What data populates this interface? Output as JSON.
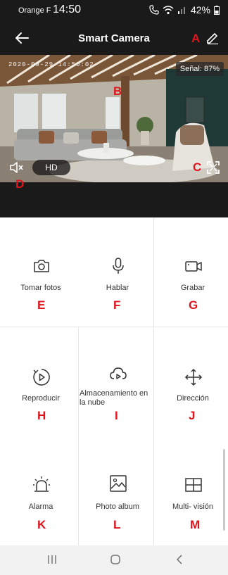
{
  "status_bar": {
    "carrier": "Orange F",
    "time": "14:50",
    "battery": "42%"
  },
  "app_bar": {
    "title": "Smart Camera"
  },
  "video": {
    "timestamp": "2020-09-29 14:50:02",
    "signal": "Señal: 87%",
    "quality": "HD"
  },
  "annotations": {
    "a": "A",
    "b": "B",
    "c": "C",
    "d": "D",
    "e": "E",
    "f": "F",
    "g": "G",
    "h": "H",
    "i": "I",
    "j": "J",
    "k": "K",
    "l": "L",
    "m": "M"
  },
  "tiles": [
    {
      "label": "Tomar fotos",
      "icon": "camera-icon"
    },
    {
      "label": "Hablar",
      "icon": "microphone-icon"
    },
    {
      "label": "Grabar",
      "icon": "video-record-icon"
    },
    {
      "label": "Reproducir",
      "icon": "playback-icon"
    },
    {
      "label": "Almacenamiento en la nube",
      "icon": "cloud-play-icon"
    },
    {
      "label": "Dirección",
      "icon": "direction-arrows-icon"
    },
    {
      "label": "Alarma",
      "icon": "alarm-siren-icon"
    },
    {
      "label": "Photo album",
      "icon": "image-icon"
    },
    {
      "label": "Multi- visión",
      "icon": "multi-view-icon"
    }
  ],
  "colors": {
    "app_bar": "#1a1a1a",
    "annotation": "#e0141c",
    "icon": "#333333"
  }
}
